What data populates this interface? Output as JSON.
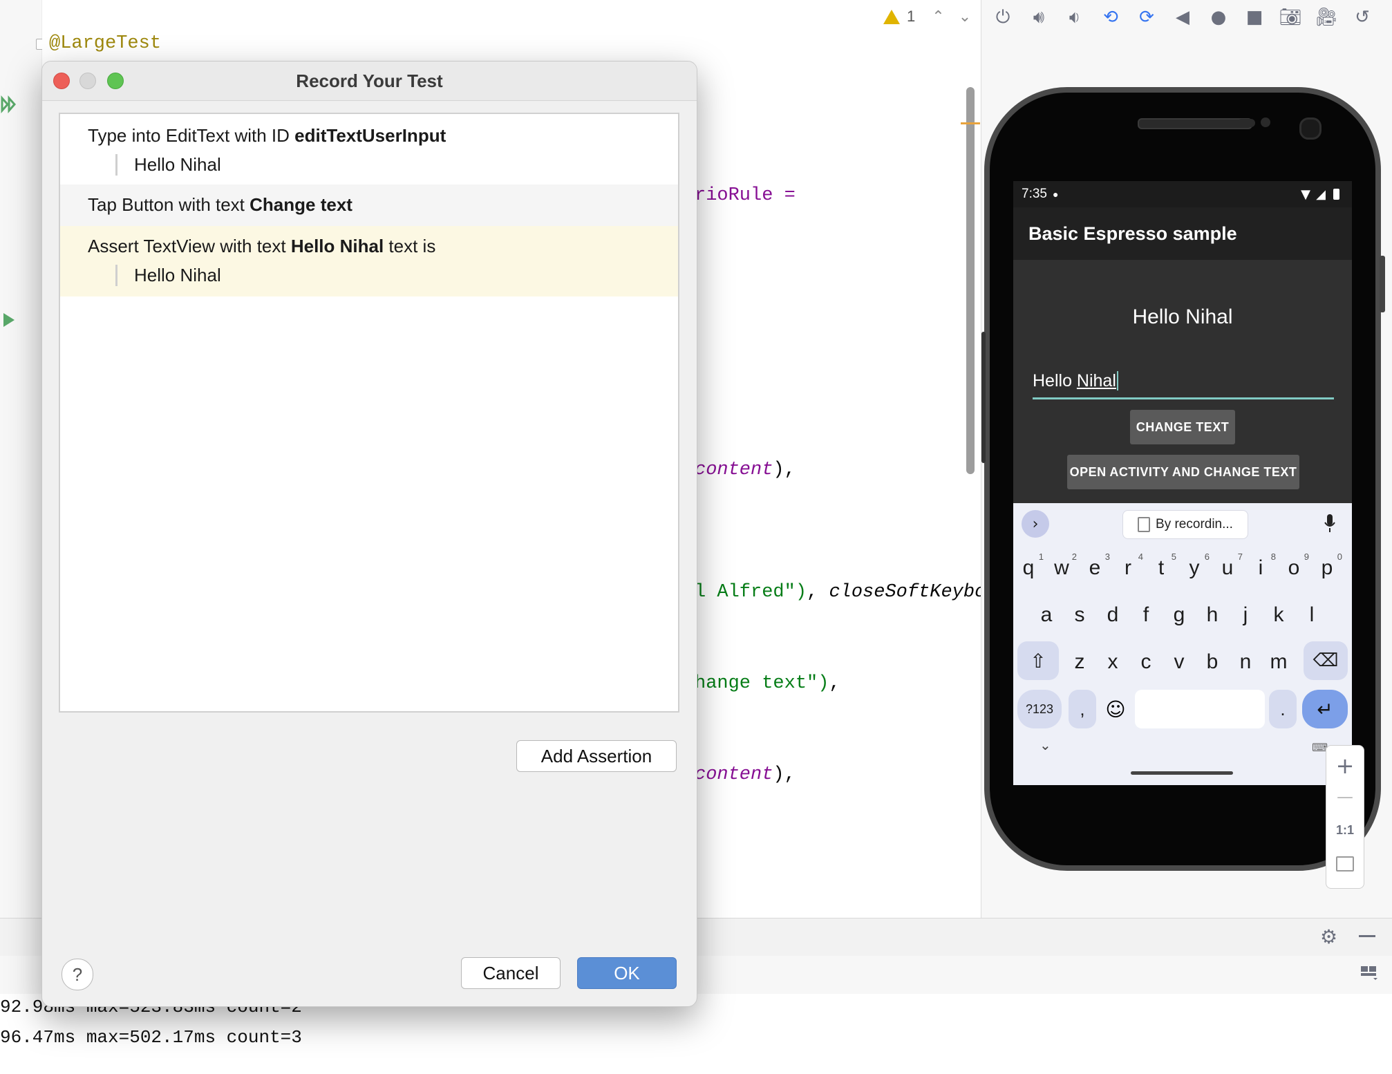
{
  "editor": {
    "annotation": "@LargeTest",
    "lines": {
      "rule_fragment": "rioRule =",
      "content_1": "content",
      "content_1_tail": "),",
      "alfred_str": "l Alfred\")",
      "alfred_tail": ", ",
      "alfred_method": "closeSoftKeybo",
      "change_str": "hange text\")",
      "change_tail": ",",
      "content_2": "content",
      "content_2_tail": "),"
    },
    "warning_count": "1"
  },
  "emulator_toolbar": {
    "icons": [
      "power-icon",
      "volume-up-icon",
      "volume-down-icon",
      "rotate-left-icon",
      "rotate-right-icon",
      "back-icon",
      "home-icon",
      "overview-icon",
      "screenshot-icon",
      "screen-record-icon",
      "snapshot-icon",
      "more-icon"
    ]
  },
  "phone": {
    "status_time": "7:35",
    "app_title": "Basic Espresso sample",
    "hello_text": "Hello Nihal",
    "edit_text_value_plain": "Hello ",
    "edit_text_value_underlined": "Nihal",
    "change_text_button": "CHANGE TEXT",
    "open_activity_button": "OPEN ACTIVITY AND CHANGE TEXT",
    "keyboard": {
      "suggestion": "By recordin...",
      "row1": [
        {
          "k": "q",
          "n": "1"
        },
        {
          "k": "w",
          "n": "2"
        },
        {
          "k": "e",
          "n": "3"
        },
        {
          "k": "r",
          "n": "4"
        },
        {
          "k": "t",
          "n": "5"
        },
        {
          "k": "y",
          "n": "6"
        },
        {
          "k": "u",
          "n": "7"
        },
        {
          "k": "i",
          "n": "8"
        },
        {
          "k": "o",
          "n": "9"
        },
        {
          "k": "p",
          "n": "0"
        }
      ],
      "row2": [
        "a",
        "s",
        "d",
        "f",
        "g",
        "h",
        "j",
        "k",
        "l"
      ],
      "row3": [
        "z",
        "x",
        "c",
        "v",
        "b",
        "n",
        "m"
      ],
      "symbols_key": "?123",
      "comma_key": ",",
      "period_key": "."
    },
    "zoom": {
      "plus": "+",
      "minus": "—",
      "one_to_one": "1:1"
    }
  },
  "dialog": {
    "title": "Record Your Test",
    "steps": [
      {
        "prefix": "Type into EditText with ID ",
        "bold": "editTextUserInput",
        "suffix": "",
        "sub": "Hello Nihal"
      },
      {
        "prefix": "Tap Button with text ",
        "bold": "Change text",
        "suffix": "",
        "sub": ""
      },
      {
        "prefix": "Assert TextView with text ",
        "bold": "Hello Nihal",
        "suffix": " text is",
        "sub": "Hello Nihal"
      }
    ],
    "add_assertion": "Add Assertion",
    "cancel": "Cancel",
    "ok": "OK",
    "help": "?"
  },
  "console": {
    "lines": [
      "92.98ms max=523.83ms count=2",
      "96.47ms max=502.17ms count=3"
    ]
  },
  "colors": {
    "ok_button": "#5b8fd6",
    "highlight_row": "#fcf8e3",
    "selected_row": "#f5f5f5"
  }
}
